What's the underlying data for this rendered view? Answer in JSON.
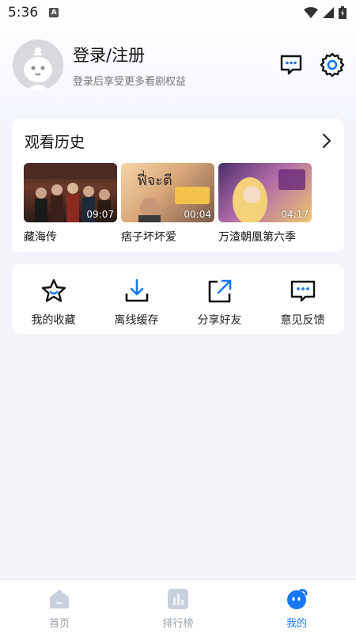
{
  "status_bar": {
    "time": "5:36",
    "notification_letter": "A"
  },
  "profile": {
    "title": "登录/注册",
    "subtitle": "登录后享受更多看剧权益"
  },
  "history": {
    "title": "观看历史",
    "items": [
      {
        "name": "藏海传",
        "duration": "09:07"
      },
      {
        "name": "痞子坏坏爱",
        "duration": "00:04"
      },
      {
        "name": "万渣朝凰第六季",
        "duration": "04:17"
      }
    ]
  },
  "functions": [
    {
      "label": "我的收藏",
      "icon": "star-icon"
    },
    {
      "label": "离线缓存",
      "icon": "download-icon"
    },
    {
      "label": "分享好友",
      "icon": "share-icon"
    },
    {
      "label": "意见反馈",
      "icon": "feedback-icon"
    }
  ],
  "nav": [
    {
      "label": "首页",
      "icon": "home-icon",
      "active": false
    },
    {
      "label": "排行榜",
      "icon": "ranking-icon",
      "active": false
    },
    {
      "label": "我的",
      "icon": "mine-icon",
      "active": true
    }
  ],
  "colors": {
    "accent": "#1778f2",
    "background": "#f3f5fa",
    "card": "#ffffff",
    "inactive": "#9aa0aa"
  }
}
